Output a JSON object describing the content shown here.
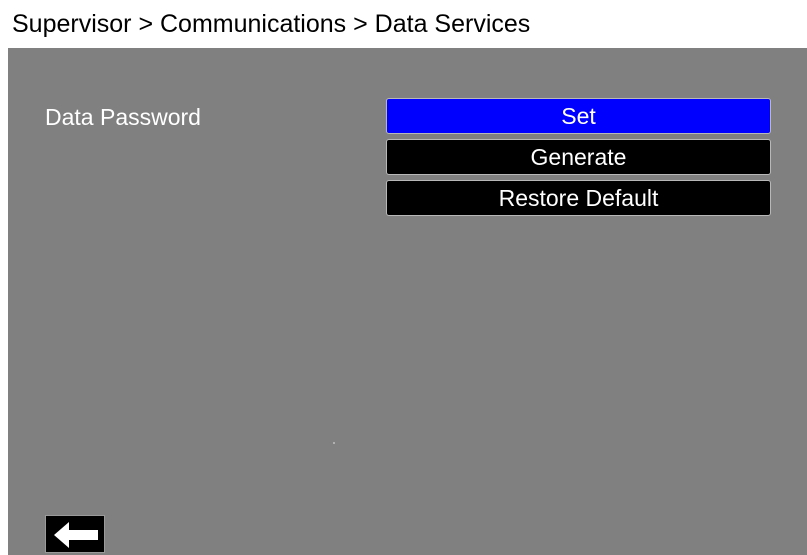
{
  "header": {
    "breadcrumb": "Supervisor > Communications > Data Services"
  },
  "settings": {
    "data_password_label": "Data Password",
    "buttons": [
      {
        "label": "Set",
        "selected": true
      },
      {
        "label": "Generate",
        "selected": false
      },
      {
        "label": "Restore Default",
        "selected": false
      }
    ]
  },
  "footer": {
    "back_icon": "arrow-left-icon"
  },
  "colors": {
    "panel_background": "#808080",
    "selected_button": "#0000ff",
    "button_background": "#000000",
    "text": "#ffffff"
  }
}
